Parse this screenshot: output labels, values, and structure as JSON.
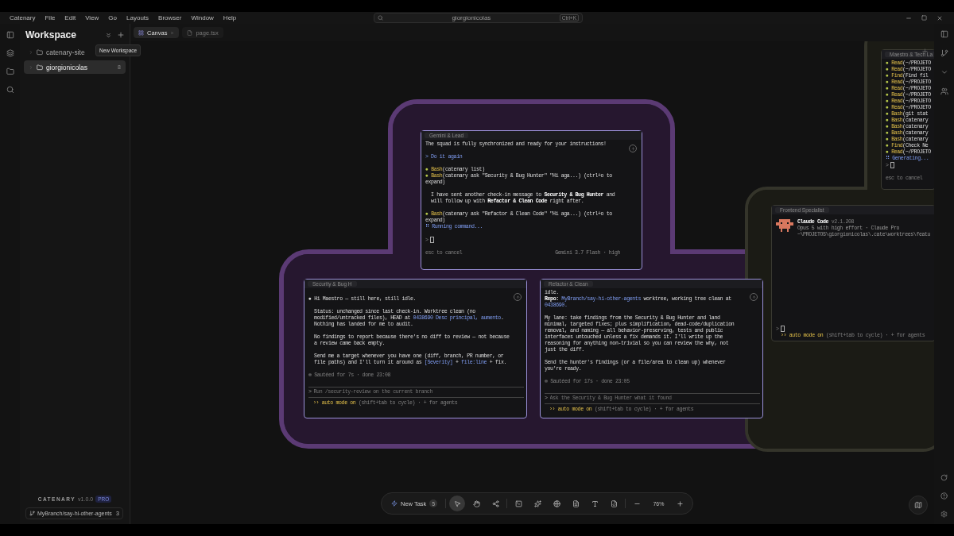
{
  "menu": [
    "Catenary",
    "File",
    "Edit",
    "View",
    "Go",
    "Layouts",
    "Browser",
    "Window",
    "Help"
  ],
  "search": {
    "value": "giorgionicolas",
    "shortcut": "Ctrl+K"
  },
  "sidebar": {
    "title": "Workspace",
    "tooltip": "New Workspace",
    "tree": [
      {
        "label": "catenary-site",
        "selected": false
      },
      {
        "label": "giorgionicolas",
        "count": "8",
        "selected": true
      }
    ],
    "brand": {
      "name": "CATENARY",
      "version": "v1.0.0",
      "badge": "PRO"
    },
    "branch": {
      "name": "MyBranch/say-hi-other-agents",
      "count": "3"
    }
  },
  "tabs": [
    {
      "label": "Canvas",
      "kind": "canvas",
      "selected": true
    },
    {
      "label": "page.tsx",
      "kind": "file",
      "selected": false
    }
  ],
  "terminals": [
    {
      "title": "Gemini & Lead",
      "lines": [
        {
          "kind": "text",
          "segs": [
            {
              "text": "The squad is fully synchronized and ready for your instructions!",
              "kind": "plain"
            }
          ]
        },
        {
          "kind": "gap"
        },
        {
          "kind": "text",
          "segs": [
            {
              "text": "> Do it again",
              "kind": "accent"
            }
          ]
        },
        {
          "kind": "gap"
        },
        {
          "kind": "text",
          "segs": [
            {
              "text": "● ",
              "kind": "bullet"
            },
            {
              "text": "Bash",
              "kind": "tool"
            },
            {
              "text": "(catenary list)",
              "kind": "plain"
            }
          ]
        },
        {
          "kind": "text",
          "segs": [
            {
              "text": "● ",
              "kind": "bullet"
            },
            {
              "text": "Bash",
              "kind": "tool"
            },
            {
              "text": "(catenary ask \"Security & Bug Hunter\" \"Hi aga...) (ctrl+o to",
              "kind": "plain"
            }
          ]
        },
        {
          "kind": "text",
          "segs": [
            {
              "text": "expand)",
              "kind": "plain"
            }
          ]
        },
        {
          "kind": "gap"
        },
        {
          "kind": "text",
          "segs": [
            {
              "text": "  I have sent another check-in message to ",
              "kind": "plain"
            },
            {
              "text": "Security & Bug Hunter",
              "kind": "strong"
            },
            {
              "text": " and",
              "kind": "plain"
            }
          ]
        },
        {
          "kind": "text",
          "segs": [
            {
              "text": "  will follow up with ",
              "kind": "plain"
            },
            {
              "text": "Refactor & Clean Code",
              "kind": "strong"
            },
            {
              "text": " right after.",
              "kind": "plain"
            }
          ]
        },
        {
          "kind": "gap"
        },
        {
          "kind": "text",
          "segs": [
            {
              "text": "● ",
              "kind": "bullet"
            },
            {
              "text": "Bash",
              "kind": "tool"
            },
            {
              "text": "(catenary ask \"Refactor & Clean Code\" \"Hi aga...) (ctrl+o to",
              "kind": "plain"
            }
          ]
        },
        {
          "kind": "text",
          "segs": [
            {
              "text": "expand)",
              "kind": "plain"
            }
          ]
        },
        {
          "kind": "text",
          "segs": [
            {
              "text": "⠿ Running command...",
              "kind": "accent"
            }
          ]
        },
        {
          "kind": "gap"
        },
        {
          "kind": "prompt",
          "segs": [
            {
              "text": ">",
              "kind": "muted"
            }
          ]
        },
        {
          "kind": "gap"
        },
        {
          "kind": "status",
          "segs": [
            {
              "text": "esc to cancel",
              "kind": "muted"
            }
          ],
          "right": "Gemini 3.7 Flash · high"
        }
      ]
    },
    {
      "title": "Security & Bug H",
      "lines": [
        {
          "kind": "gap"
        },
        {
          "kind": "text",
          "segs": [
            {
              "text": "● ",
              "kind": "plain"
            },
            {
              "text": "Hi Maestro — still here, still idle.",
              "kind": "plain"
            }
          ]
        },
        {
          "kind": "gap"
        },
        {
          "kind": "text",
          "segs": [
            {
              "text": "  Status: unchanged since last check-in. Worktree clean (no",
              "kind": "plain"
            }
          ]
        },
        {
          "kind": "text",
          "segs": [
            {
              "text": "  modified/untracked files), HEAD at ",
              "kind": "plain"
            },
            {
              "text": "0438690 Desc principal, aumento",
              "kind": "accent"
            },
            {
              "text": ".",
              "kind": "plain"
            }
          ]
        },
        {
          "kind": "text",
          "segs": [
            {
              "text": "  Nothing has landed for me to audit.",
              "kind": "plain"
            }
          ]
        },
        {
          "kind": "gap"
        },
        {
          "kind": "text",
          "segs": [
            {
              "text": "  No findings to report because there's no diff to review — not because",
              "kind": "plain"
            }
          ]
        },
        {
          "kind": "text",
          "segs": [
            {
              "text": "  a review came back empty.",
              "kind": "plain"
            }
          ]
        },
        {
          "kind": "gap"
        },
        {
          "kind": "text",
          "segs": [
            {
              "text": "  Send me a target whenever you have one (diff, branch, PR number, or",
              "kind": "plain"
            }
          ]
        },
        {
          "kind": "text",
          "segs": [
            {
              "text": "  file paths) and I'll turn it around as ",
              "kind": "plain"
            },
            {
              "text": "[Severity]",
              "kind": "accent"
            },
            {
              "text": " + ",
              "kind": "plain"
            },
            {
              "text": "file:line",
              "kind": "accent"
            },
            {
              "text": " + fix.",
              "kind": "plain"
            }
          ]
        },
        {
          "kind": "gap"
        },
        {
          "kind": "text",
          "segs": [
            {
              "text": "✻ Sautéed for 7s · done 23:08",
              "kind": "muted"
            }
          ]
        },
        {
          "kind": "gap"
        },
        {
          "kind": "input",
          "symbol": ">",
          "placeholder": "Run /security-review on the current branch"
        },
        {
          "kind": "footer",
          "segs": [
            {
              "text": "›› auto mode on",
              "kind": "tool"
            },
            {
              "text": " (shift+tab to cycle) · + for agents",
              "kind": "muted"
            }
          ]
        }
      ]
    },
    {
      "title": "Refactor & Clean",
      "lines": [
        {
          "kind": "text",
          "segs": [
            {
              "text": "idle.",
              "kind": "plain"
            }
          ]
        },
        {
          "kind": "text",
          "segs": [
            {
              "text": "Repo:",
              "kind": "strong"
            },
            {
              "text": " MyBranch/say-hi-other-agents",
              "kind": "accent"
            },
            {
              "text": " worktree, working tree clean at",
              "kind": "plain"
            }
          ]
        },
        {
          "kind": "text",
          "segs": [
            {
              "text": "0438690.",
              "kind": "accent"
            }
          ]
        },
        {
          "kind": "gap"
        },
        {
          "kind": "text",
          "segs": [
            {
              "text": "My lane: take findings from the Security & Bug Hunter and land",
              "kind": "plain"
            }
          ]
        },
        {
          "kind": "text",
          "segs": [
            {
              "text": "minimal, targeted fixes; plus simplification, dead-code/duplication",
              "kind": "plain"
            }
          ]
        },
        {
          "kind": "text",
          "segs": [
            {
              "text": "removal, and naming — all behavior-preserving, tests and public",
              "kind": "plain"
            }
          ]
        },
        {
          "kind": "text",
          "segs": [
            {
              "text": "interfaces untouched unless a fix demands it. I'll write up the",
              "kind": "plain"
            }
          ]
        },
        {
          "kind": "text",
          "segs": [
            {
              "text": "reasoning for anything non-trivial so you can review the why, not",
              "kind": "plain"
            }
          ]
        },
        {
          "kind": "text",
          "segs": [
            {
              "text": "just the diff.",
              "kind": "plain"
            }
          ]
        },
        {
          "kind": "gap"
        },
        {
          "kind": "text",
          "segs": [
            {
              "text": "Send the hunter's findings (or a file/area to clean up) whenever",
              "kind": "plain"
            }
          ]
        },
        {
          "kind": "text",
          "segs": [
            {
              "text": "you're ready.",
              "kind": "plain"
            }
          ]
        },
        {
          "kind": "gap"
        },
        {
          "kind": "text",
          "segs": [
            {
              "text": "✻ Sautéed for 17s · done 23:05",
              "kind": "muted"
            }
          ]
        },
        {
          "kind": "gap"
        },
        {
          "kind": "input",
          "symbol": ">",
          "placeholder": "Ask the Security & Bug Hunter what it found"
        },
        {
          "kind": "footer",
          "segs": [
            {
              "text": "›› auto mode on",
              "kind": "tool"
            },
            {
              "text": " (shift+tab to cycle) · + for agents",
              "kind": "muted"
            }
          ]
        }
      ]
    },
    {
      "title": "Maestro & Tech La",
      "lines": [
        {
          "kind": "text",
          "segs": [
            {
              "text": "● ",
              "kind": "bullet"
            },
            {
              "text": "Read",
              "kind": "tool"
            },
            {
              "text": "(~/PROJETO",
              "kind": "plain"
            }
          ]
        },
        {
          "kind": "text",
          "segs": [
            {
              "text": "● ",
              "kind": "bullet"
            },
            {
              "text": "Read",
              "kind": "tool"
            },
            {
              "text": "(~/PROJETO",
              "kind": "plain"
            }
          ]
        },
        {
          "kind": "text",
          "segs": [
            {
              "text": "● ",
              "kind": "bullet"
            },
            {
              "text": "Find",
              "kind": "tool"
            },
            {
              "text": "(Find fil",
              "kind": "plain"
            }
          ]
        },
        {
          "kind": "text",
          "segs": [
            {
              "text": "● ",
              "kind": "bullet"
            },
            {
              "text": "Read",
              "kind": "tool"
            },
            {
              "text": "(~/PROJETO",
              "kind": "plain"
            }
          ]
        },
        {
          "kind": "text",
          "segs": [
            {
              "text": "● ",
              "kind": "bullet"
            },
            {
              "text": "Read",
              "kind": "tool"
            },
            {
              "text": "(~/PROJETO",
              "kind": "plain"
            }
          ]
        },
        {
          "kind": "text",
          "segs": [
            {
              "text": "● ",
              "kind": "bullet"
            },
            {
              "text": "Read",
              "kind": "tool"
            },
            {
              "text": "(~/PROJETO",
              "kind": "plain"
            }
          ]
        },
        {
          "kind": "text",
          "segs": [
            {
              "text": "● ",
              "kind": "bullet"
            },
            {
              "text": "Read",
              "kind": "tool"
            },
            {
              "text": "(~/PROJETO",
              "kind": "plain"
            }
          ]
        },
        {
          "kind": "text",
          "segs": [
            {
              "text": "● ",
              "kind": "bullet"
            },
            {
              "text": "Read",
              "kind": "tool"
            },
            {
              "text": "(~/PROJETO",
              "kind": "plain"
            }
          ]
        },
        {
          "kind": "text",
          "segs": [
            {
              "text": "● ",
              "kind": "bullet"
            },
            {
              "text": "Bash",
              "kind": "tool"
            },
            {
              "text": "(git stat",
              "kind": "plain"
            }
          ]
        },
        {
          "kind": "text",
          "segs": [
            {
              "text": "● ",
              "kind": "bullet"
            },
            {
              "text": "Bash",
              "kind": "tool"
            },
            {
              "text": "(catenary",
              "kind": "plain"
            }
          ]
        },
        {
          "kind": "text",
          "segs": [
            {
              "text": "● ",
              "kind": "bullet"
            },
            {
              "text": "Bash",
              "kind": "tool"
            },
            {
              "text": "(catenary",
              "kind": "plain"
            }
          ]
        },
        {
          "kind": "text",
          "segs": [
            {
              "text": "● ",
              "kind": "bullet"
            },
            {
              "text": "Bash",
              "kind": "tool"
            },
            {
              "text": "(catenary",
              "kind": "plain"
            }
          ]
        },
        {
          "kind": "text",
          "segs": [
            {
              "text": "● ",
              "kind": "bullet"
            },
            {
              "text": "Bash",
              "kind": "tool"
            },
            {
              "text": "(catenary",
              "kind": "plain"
            }
          ]
        },
        {
          "kind": "text",
          "segs": [
            {
              "text": "● ",
              "kind": "bullet"
            },
            {
              "text": "Find",
              "kind": "tool"
            },
            {
              "text": "(Check Ne",
              "kind": "plain"
            }
          ]
        },
        {
          "kind": "text",
          "segs": [
            {
              "text": "● ",
              "kind": "bullet"
            },
            {
              "text": "Read",
              "kind": "tool"
            },
            {
              "text": "(~/PROJETO",
              "kind": "plain"
            }
          ]
        },
        {
          "kind": "text",
          "segs": [
            {
              "text": "⠿ Generating...",
              "kind": "accent"
            }
          ]
        },
        {
          "kind": "prompt",
          "segs": [
            {
              "text": ">",
              "kind": "muted"
            }
          ]
        },
        {
          "kind": "gap"
        },
        {
          "kind": "status",
          "segs": [
            {
              "text": "esc to cancel",
              "kind": "muted"
            }
          ]
        }
      ]
    },
    {
      "title": "Frontend Specialist",
      "lines": [
        {
          "kind": "banner",
          "segs": [
            {
              "text": "Claude Code",
              "kind": "strong"
            },
            {
              "text": " v2.1.208",
              "kind": "muted"
            }
          ],
          "sub": [
            "Opus 5 with high effort · Claude Pro",
            "~\\PROJETOS\\giorgionicolas\\.cate\\worktrees\\featu"
          ]
        },
        {
          "kind": "spacer"
        },
        {
          "kind": "prompt",
          "segs": [
            {
              "text": ">",
              "kind": "muted"
            }
          ]
        },
        {
          "kind": "footer",
          "segs": [
            {
              "text": "›› auto mode on",
              "kind": "tool"
            },
            {
              "text": " (shift+tab to cycle) · + for agents",
              "kind": "muted"
            }
          ]
        }
      ]
    }
  ],
  "toolbar": {
    "new_task": "New Task",
    "task_count": "5",
    "tools": [
      {
        "kind": "pointer",
        "selected": true
      },
      {
        "kind": "hand",
        "selected": false
      },
      {
        "kind": "share",
        "selected": false
      },
      {
        "kind": "sep"
      },
      {
        "kind": "terminal",
        "selected": false
      },
      {
        "kind": "sparkle",
        "selected": false
      },
      {
        "kind": "globe",
        "selected": false
      },
      {
        "kind": "file",
        "selected": false
      },
      {
        "kind": "text",
        "selected": false
      },
      {
        "kind": "code",
        "selected": false
      }
    ],
    "zoom": "76%"
  }
}
